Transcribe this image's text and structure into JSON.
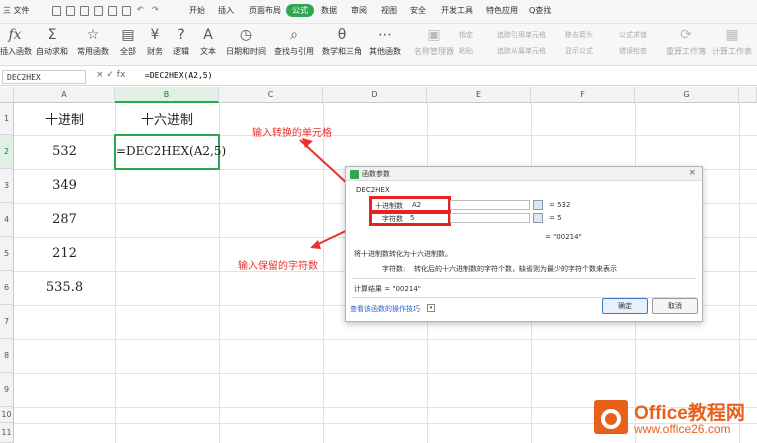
{
  "menubar": {
    "file_label": "三 文件",
    "tabs": [
      "开始",
      "插入",
      "页面布局",
      "公式",
      "数据",
      "审阅",
      "视图",
      "安全",
      "开发工具",
      "特色应用"
    ],
    "search_label": "Q查找"
  },
  "ribbon": {
    "buttons": [
      "插入函数",
      "自动求和",
      "常用函数",
      "全部",
      "财务",
      "逻辑",
      "文本",
      "日期和时间",
      "查找与引用",
      "数学和三角",
      "其他函数"
    ],
    "small_items": [
      "名称管理器",
      "指定",
      "粘贴",
      "追踪引用单元格",
      "追踪从属单元格",
      "移去箭头",
      "显示公式",
      "公式求值",
      "错误检查",
      "重算工作簿",
      "计算工作表"
    ]
  },
  "formula_bar": {
    "name_box": "DEC2HEX",
    "icons": "× ✓ fx",
    "formula": "=DEC2HEX(A2,5)"
  },
  "columns": [
    "A",
    "B",
    "C",
    "D",
    "E",
    "F",
    "G"
  ],
  "rows": [
    "1",
    "2",
    "3",
    "4",
    "5",
    "6",
    "7",
    "8",
    "9",
    "10",
    "11"
  ],
  "cells": {
    "A1": "十进制",
    "B1": "十六进制",
    "A2": "532",
    "B2": "=DEC2HEX(A2,5)",
    "A3": "349",
    "A4": "287",
    "A5": "212",
    "A6": "535.8"
  },
  "annotations": {
    "top": "输入转换的单元格",
    "bottom": "输入保留的字符数"
  },
  "dialog": {
    "title": "函数参数",
    "close": "×",
    "function_name": "DEC2HEX",
    "arg1_label": "十进制数",
    "arg1_value": "A2",
    "arg1_result": "= 532",
    "arg2_label": "字符数",
    "arg2_value": "5",
    "arg2_result": "= 5",
    "overall_result": "= \"00214\"",
    "description": "将十进制数转化为十六进制数。",
    "param_desc_label": "字符数:",
    "param_desc": "转化后的十六进制数的字符个数，缺省则为最少的字符个数来表示",
    "calc_result": "计算结果 = \"00214\"",
    "help_link": "查看该函数的操作技巧",
    "ok": "确定",
    "cancel": "取消"
  },
  "watermark": {
    "line1": "Office教程网",
    "line2": "www.office26.com"
  },
  "colors": {
    "accent": "#2ea84f",
    "annotation": "#e8322c",
    "brand": "#e8611c"
  }
}
